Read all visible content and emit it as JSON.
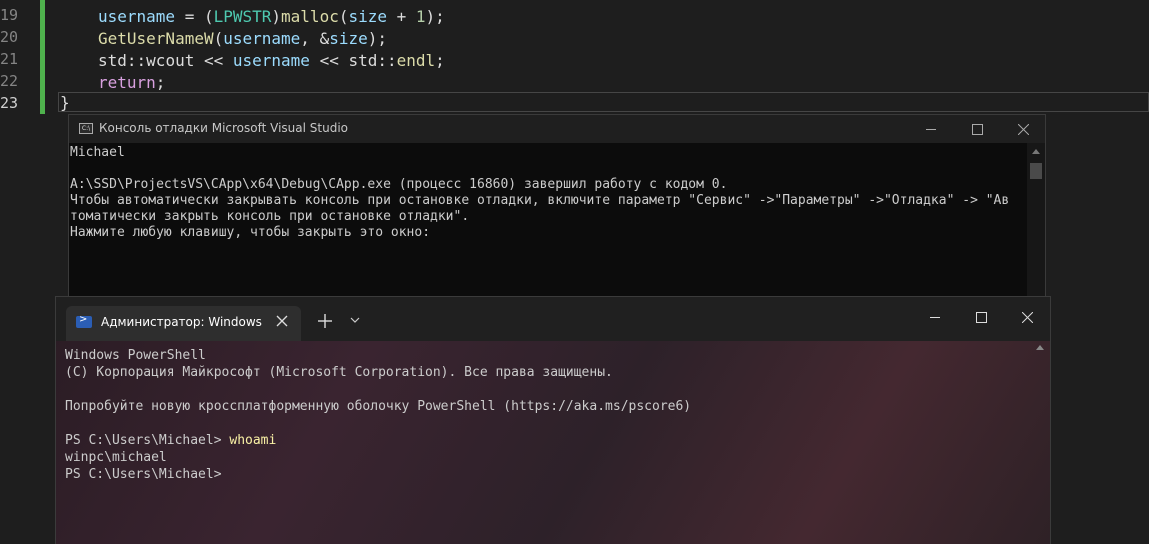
{
  "editor": {
    "line_numbers": [
      "19",
      "20",
      "21",
      "22",
      "23"
    ],
    "lines": [
      {
        "segments": [
          {
            "t": "username",
            "c": "var"
          },
          {
            "t": " = (",
            "c": "txt"
          },
          {
            "t": "LPWSTR",
            "c": "type"
          },
          {
            "t": ")",
            "c": "txt"
          },
          {
            "t": "malloc",
            "c": "fn"
          },
          {
            "t": "(",
            "c": "txt"
          },
          {
            "t": "size",
            "c": "var"
          },
          {
            "t": " + ",
            "c": "txt"
          },
          {
            "t": "1",
            "c": "num"
          },
          {
            "t": ");",
            "c": "txt"
          }
        ]
      },
      {
        "segments": [
          {
            "t": "GetUserNameW",
            "c": "fn"
          },
          {
            "t": "(",
            "c": "txt"
          },
          {
            "t": "username",
            "c": "var"
          },
          {
            "t": ", &",
            "c": "txt"
          },
          {
            "t": "size",
            "c": "var"
          },
          {
            "t": ");",
            "c": "txt"
          }
        ]
      },
      {
        "segments": [
          {
            "t": "std",
            "c": "txt"
          },
          {
            "t": "::",
            "c": "txt"
          },
          {
            "t": "wcout",
            "c": "txt"
          },
          {
            "t": " << ",
            "c": "txt"
          },
          {
            "t": "username",
            "c": "var"
          },
          {
            "t": " << ",
            "c": "txt"
          },
          {
            "t": "std",
            "c": "txt"
          },
          {
            "t": "::",
            "c": "txt"
          },
          {
            "t": "endl",
            "c": "fn"
          },
          {
            "t": ";",
            "c": "txt"
          }
        ]
      },
      {
        "segments": [
          {
            "t": "return",
            "c": "kw"
          },
          {
            "t": ";",
            "c": "txt"
          }
        ]
      }
    ],
    "closing_brace": "}"
  },
  "debug_console": {
    "title": "Консоль отладки Microsoft Visual Studio",
    "icon_label": "C:\\",
    "lines": [
      "Michael",
      "",
      "A:\\SSD\\ProjectsVS\\CApp\\x64\\Debug\\CApp.exe (процесс 16860) завершил работу с кодом 0.",
      "Чтобы автоматически закрывать консоль при остановке отладки, включите параметр \"Сервис\" ->\"Параметры\" ->\"Отладка\" -> \"Ав",
      "томатически закрыть консоль при остановке отладки\".",
      "Нажмите любую клавишу, чтобы закрыть это окно:"
    ]
  },
  "terminal": {
    "tab_title": "Администратор: Windows PowerShell",
    "ps_icon_glyph": ">",
    "lines": [
      {
        "text": "Windows PowerShell"
      },
      {
        "text": "(C) Корпорация Майкрософт (Microsoft Corporation). Все права защищены."
      },
      {
        "text": ""
      },
      {
        "text": "Попробуйте новую кроссплатформенную оболочку PowerShell (https://aka.ms/pscore6)"
      },
      {
        "text": ""
      },
      {
        "prompt": "PS C:\\Users\\Michael> ",
        "cmd": "whoami"
      },
      {
        "text": "winpc\\michael"
      },
      {
        "prompt": "PS C:\\Users\\Michael>",
        "cmd": ""
      }
    ]
  },
  "icons": [
    "minimize-icon",
    "maximize-icon",
    "close-icon",
    "plus-icon",
    "chevron-down-icon",
    "powershell-icon",
    "console-app-icon"
  ],
  "colors": {
    "change_bar": "#4fb24d",
    "keyword": "#d8a0df",
    "function": "#dcdcaa",
    "variable": "#9cdcfe",
    "type": "#4ec9b0",
    "command": "#f9f1a5"
  }
}
